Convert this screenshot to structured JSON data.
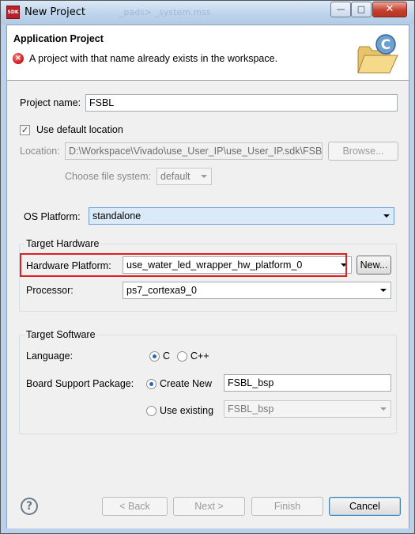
{
  "window": {
    "title": "New Project",
    "app_icon": "SDK",
    "ghost_tabs": "_pads>   _system.mss",
    "controls": {
      "minimize": "—",
      "maximize": "□",
      "close": "✕"
    }
  },
  "header": {
    "title": "Application Project",
    "error_message": "A project with that name already exists in the workspace.",
    "error_icon": "error-icon",
    "banner_icon": "c-project-folder-icon"
  },
  "project": {
    "name_label": "Project name:",
    "name_value": "FSBL",
    "use_default_location_label": "Use default location",
    "use_default_location_checked": true,
    "location_label": "Location:",
    "location_value": "D:\\Workspace\\Vivado\\use_User_IP\\use_User_IP.sdk\\FSBL",
    "browse_label": "Browse...",
    "file_system_label": "Choose file system:",
    "file_system_value": "default"
  },
  "os": {
    "label": "OS Platform:",
    "value": "standalone"
  },
  "target_hardware": {
    "group_title": "Target Hardware",
    "hw_platform_label": "Hardware Platform:",
    "hw_platform_value": "use_water_led_wrapper_hw_platform_0",
    "new_button": "New...",
    "processor_label": "Processor:",
    "processor_value": "ps7_cortexa9_0"
  },
  "target_software": {
    "group_title": "Target Software",
    "language_label": "Language:",
    "language_options": [
      "C",
      "C++"
    ],
    "language_selected": "C",
    "bsp_label": "Board Support Package:",
    "create_new_label": "Create New",
    "create_new_value": "FSBL_bsp",
    "use_existing_label": "Use existing",
    "use_existing_value": "FSBL_bsp",
    "bsp_selected": "Create New"
  },
  "footer": {
    "help_icon": "help-icon",
    "back_label": "< Back",
    "next_label": "Next >",
    "finish_label": "Finish",
    "cancel_label": "Cancel"
  },
  "colors": {
    "highlight": "#e02020",
    "selection": "#dbeaf8",
    "title_bar": "#bcd3ec"
  }
}
